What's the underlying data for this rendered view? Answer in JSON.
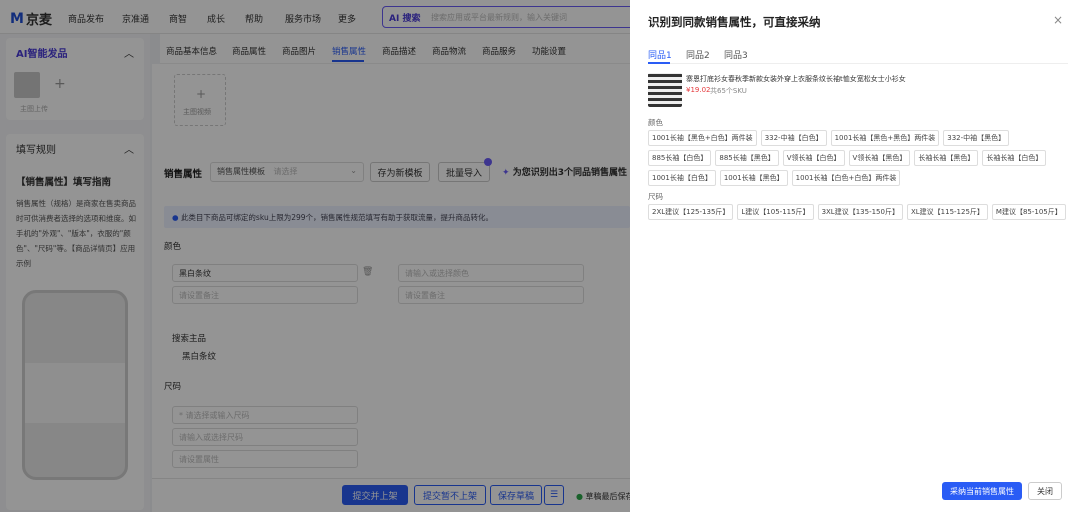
{
  "topbar": {
    "logo_m": "M",
    "logo_text": "京麦",
    "nav": [
      "商品发布",
      "京准通",
      "商智",
      "成长",
      "帮助",
      "服务市场",
      "更多"
    ],
    "ai_tag": "AI 搜索",
    "search_placeholder": "搜索应用或平台最新规则，输入关键词"
  },
  "left": {
    "ai_section_title": "AI智能发品",
    "add_label": "+",
    "upload_label": "主图上传",
    "rules_section_title": "填写规则",
    "guide_title": "【销售属性】填写指南",
    "guide_body": "销售属性（规格）是商家在售卖商品时可供消费者选择的选项和维度。如手机的\"外观\"、\"版本\"，衣服的\"颜色\"、\"尺码\"等。【商品详情页】应用示例"
  },
  "tabs": [
    "商品基本信息",
    "商品属性",
    "商品图片",
    "销售属性",
    "商品描述",
    "商品物流",
    "商品服务",
    "功能设置"
  ],
  "active_tab_index": 3,
  "main": {
    "image_add": "+",
    "image_label": "主图视频",
    "sale_attr_label": "销售属性",
    "template_label": "销售属性模板",
    "template_placeholder": "请选择",
    "save_template": "存为新模板",
    "batch_import": "批量导入",
    "ai_hint": "为您识别出3个同品销售属性",
    "notice": "此类目下商品可绑定的sku上限为299个，销售属性规范填写有助于获取流量，提升商品转化。",
    "color_label": "颜色",
    "color_value": "黑白条纹",
    "color_placeholder": "请输入或选择颜色",
    "remark_placeholder": "请设置备注",
    "search_main_label": "搜索主品",
    "search_main_value": "黑白条纹",
    "size_label": "尺码",
    "size_placeholder": "* 请选择或输入尺码",
    "size_placeholder2": "请输入或选择尺码",
    "size_remark": "请设置属性"
  },
  "footer": {
    "submit": "提交并上架",
    "submit_pending": "提交暂不上架",
    "save_draft": "保存草稿",
    "auto_save": "草稿最后保存"
  },
  "drawer": {
    "title": "识别到同款销售属性，可直接采纳",
    "tabs": [
      "同品1",
      "同品2",
      "同品3"
    ],
    "active_tab": 0,
    "product_title": "寨恩打底衫女春秋季新款女装外穿上衣服条纹长袖t恤女宽松女士小衫女",
    "price": "¥19.02",
    "sku_count": "共65个SKU",
    "color_label": "颜色",
    "colors": [
      "1001长袖【黑色+白色】两件装",
      "332-中袖【白色】",
      "1001长袖【黑色+黑色】两件装",
      "332-中袖【黑色】",
      "885长袖【白色】",
      "885长袖【黑色】",
      "V领长袖【白色】",
      "V领长袖【黑色】",
      "长袖长袖【黑色】",
      "长袖长袖【白色】",
      "1001长袖【白色】",
      "1001长袖【黑色】",
      "1001长袖【白色+白色】两件装"
    ],
    "size_label": "尺码",
    "sizes": [
      "2XL建议【125-135斤】",
      "L建议【105-115斤】",
      "3XL建议【135-150斤】",
      "XL建议【115-125斤】",
      "M建议【85-105斤】"
    ],
    "adopt_button": "采纳当前销售属性",
    "close_button": "关闭",
    "close_icon": "×"
  },
  "colors": {
    "brand_blue": "#2a5cf5",
    "ai_purple": "#6a5cf6",
    "price_red": "#e4393c"
  }
}
